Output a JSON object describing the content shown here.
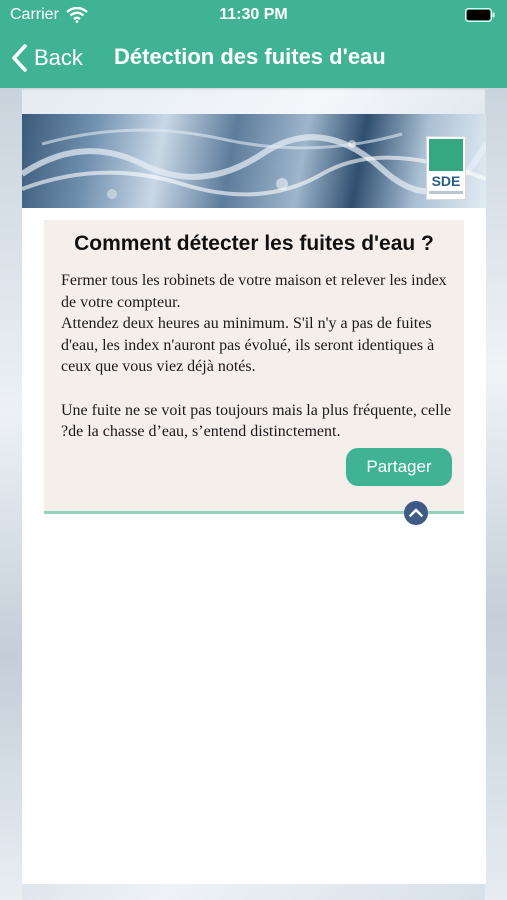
{
  "status_bar": {
    "carrier": "Carrier",
    "time": "11:30 PM",
    "icons": [
      "wifi-icon",
      "battery-icon"
    ]
  },
  "nav": {
    "back_label": "Back",
    "title": "Détection des fuites d'eau",
    "icons": [
      "chevron-left-icon"
    ]
  },
  "banner": {
    "logo_text": "SDE"
  },
  "article": {
    "title": "Comment détecter les fuites d'eau ?",
    "paragraph1": "Fermer tous les robinets de votre maison et relever les index de votre compteur.",
    "paragraph2": "Attendez deux heures au minimum. S'il n'y a pas de fuites d'eau, les index n'auront pas évolué, ils seront identiques à ceux que vous viez déjà notés.",
    "paragraph3": "Une fuite ne se voit pas toujours mais la plus fréquente, celle ?de la chasse d’eau, s’entend distinctement.",
    "share_label": "Partager",
    "collapse_icon": "chevron-up-circle-icon"
  },
  "colors": {
    "brand_green": "#3fb394",
    "panel_background": "#f5efec",
    "divider": "#8fd3be",
    "collapse_button": "#3e5a85"
  }
}
